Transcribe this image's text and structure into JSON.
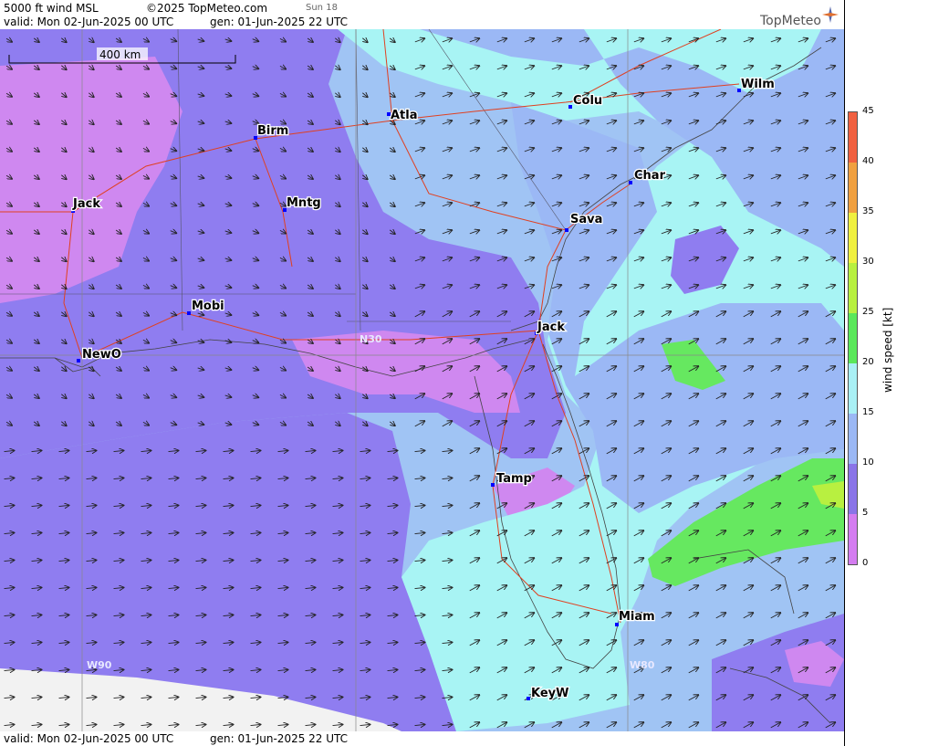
{
  "header": {
    "product": "5000 ft wind MSL",
    "copyright": "©2025 TopMeteo.com",
    "sun": "Sun 18",
    "valid": "valid:  Mon  02-Jun-2025  00 UTC",
    "gen": "gen: 01-Jun-2025 22 UTC"
  },
  "footer": {
    "valid": "valid:  Mon  02-Jun-2025  00 UTC",
    "gen": "gen: 01-Jun-2025 22 UTC"
  },
  "brand": {
    "name": "TopMeteo",
    "color": "#555555"
  },
  "scale_bar": {
    "label": "400 km"
  },
  "legend": {
    "title": "wind speed  [kt]",
    "ticks": [
      "0",
      "5",
      "10",
      "15",
      "20",
      "25",
      "30",
      "35",
      "40",
      "45"
    ],
    "colors": [
      "#d47cf0",
      "#8a74e8",
      "#9bb8f5",
      "#a9f0f5",
      "#5ae85a",
      "#b8f040",
      "#f0f040",
      "#f0a040",
      "#f06040"
    ]
  },
  "map": {
    "colors": {
      "ocean_base": "#a0c4f4",
      "land_purple": "#8f7df0",
      "magenta": "#cf88f0",
      "cyan": "#a8f4f4",
      "green": "#66e860",
      "blue": "#9bb8f5"
    },
    "grid_labels": [
      "N30",
      "W90",
      "W80"
    ],
    "cities": [
      {
        "name": "Atla"
      },
      {
        "name": "Birm"
      },
      {
        "name": "Colu"
      },
      {
        "name": "Wilm"
      },
      {
        "name": "Char"
      },
      {
        "name": "Sava"
      },
      {
        "name": "Jack"
      },
      {
        "name": "Mntg"
      },
      {
        "name": "Mobi"
      },
      {
        "name": "NewO"
      },
      {
        "name": "Jack"
      },
      {
        "name": "Tamp"
      },
      {
        "name": "Miam"
      },
      {
        "name": "KeyW"
      }
    ]
  }
}
